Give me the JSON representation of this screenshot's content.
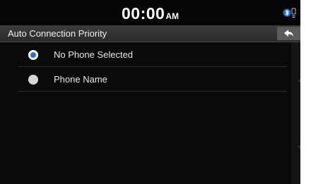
{
  "status_bar": {
    "time": "00:00",
    "ampm": "AM",
    "bluetooth_icon": "bluetooth-phone-icon"
  },
  "header": {
    "title": "Auto Connection Priority",
    "back_icon": "back-arrow-icon"
  },
  "options": [
    {
      "label": "No Phone Selected",
      "selected": true
    },
    {
      "label": "Phone Name",
      "selected": false
    }
  ],
  "colors": {
    "accent": "#2a6fd6",
    "background": "#0a0a0a",
    "header": "#353535"
  }
}
